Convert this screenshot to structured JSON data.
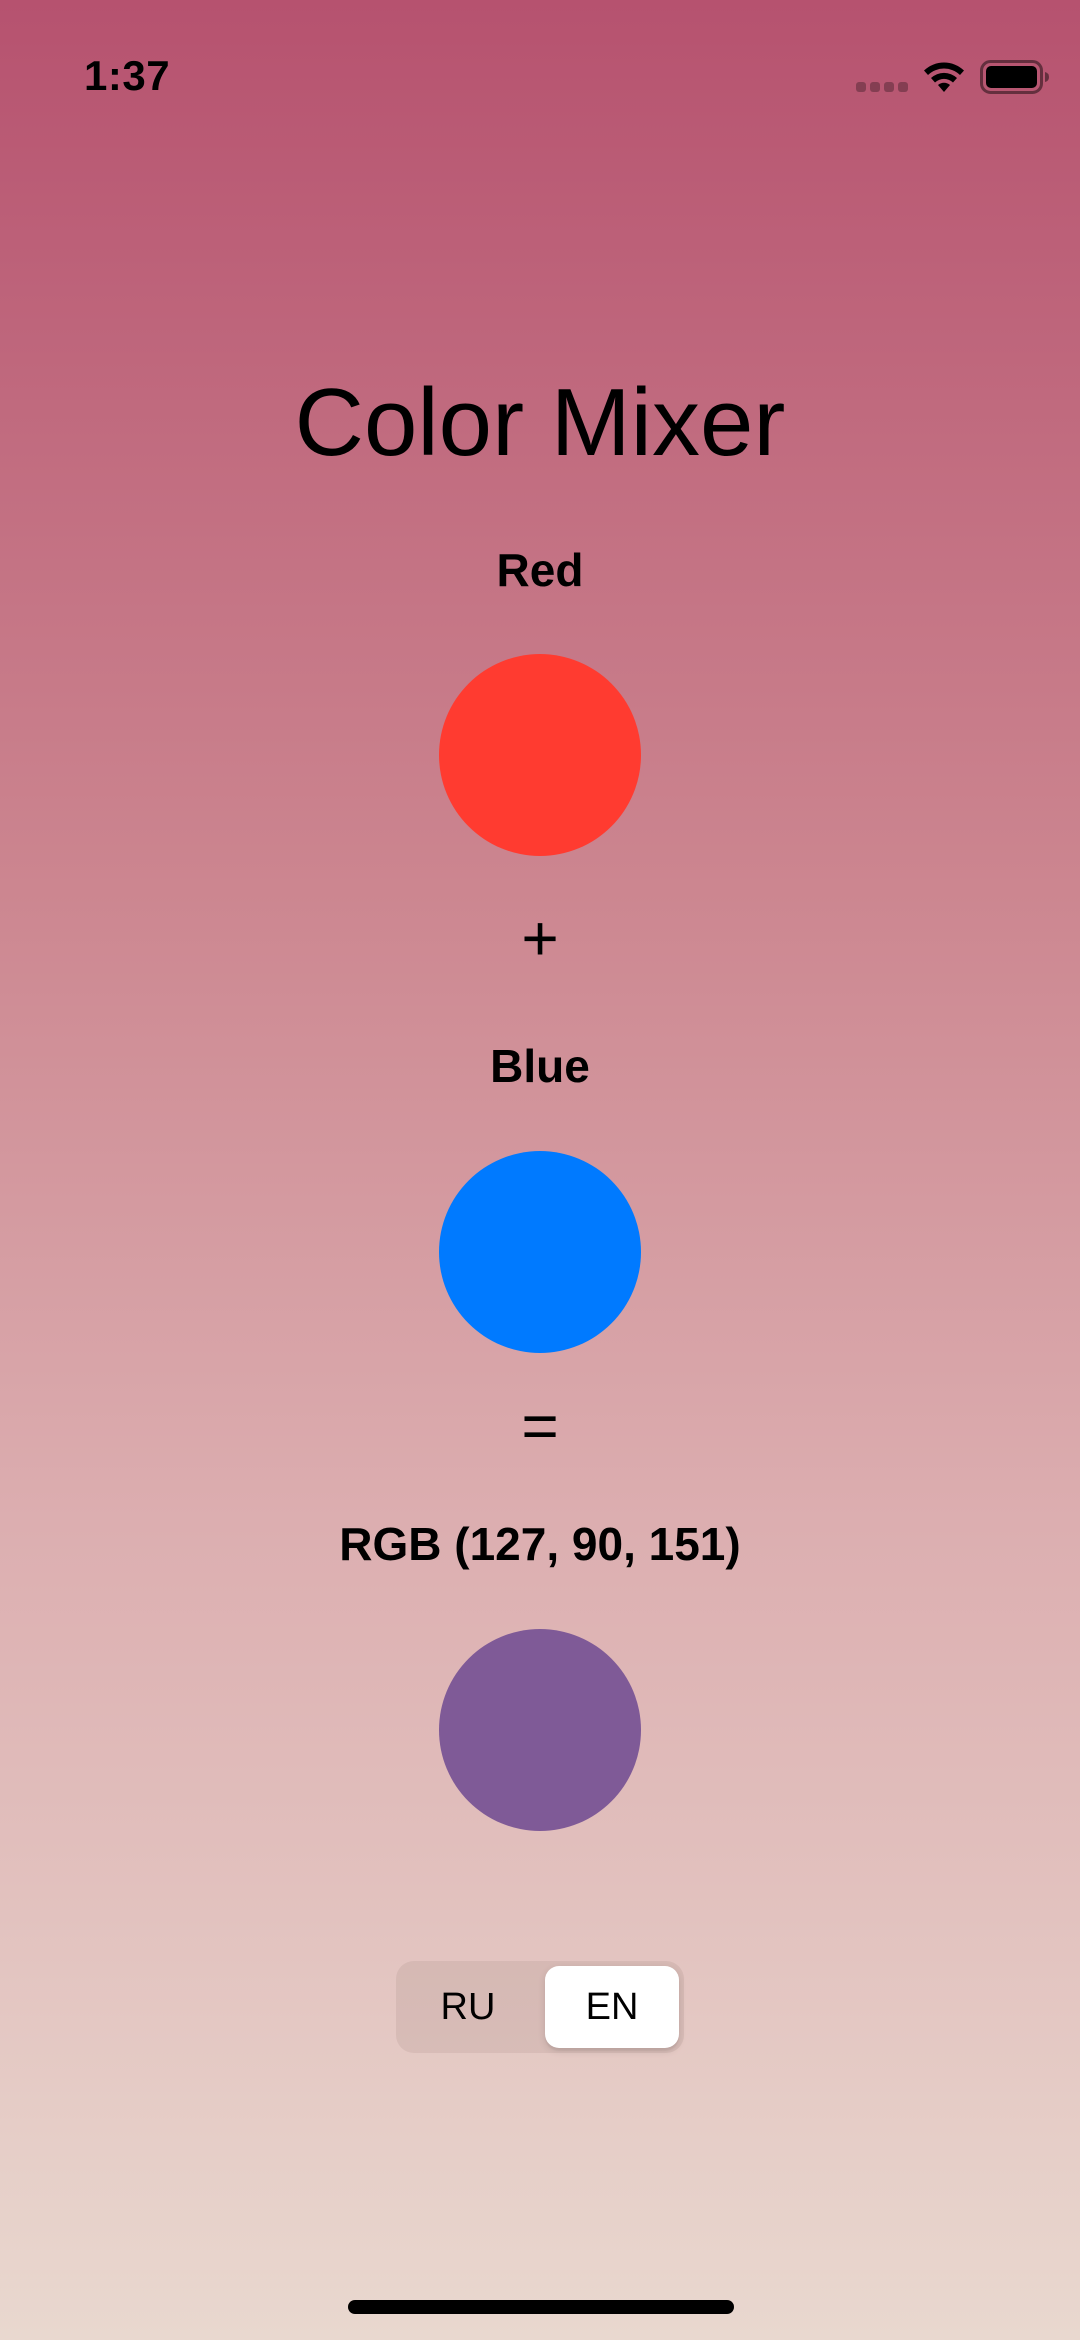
{
  "status_bar": {
    "time": "1:37"
  },
  "app": {
    "title": "Color Mixer"
  },
  "mixer": {
    "first": {
      "label": "Red",
      "color": "#ff3b30"
    },
    "operator_plus": "+",
    "second": {
      "label": "Blue",
      "color": "#007aff"
    },
    "operator_equals": "=",
    "result": {
      "label": "RGB (127, 90, 151)",
      "color": "#7f5a97"
    }
  },
  "language_switch": {
    "options": [
      "RU",
      "EN"
    ],
    "selected": "EN"
  },
  "icons": {
    "signal": "cellular-signal-icon",
    "wifi": "wifi-icon",
    "battery": "battery-icon"
  }
}
